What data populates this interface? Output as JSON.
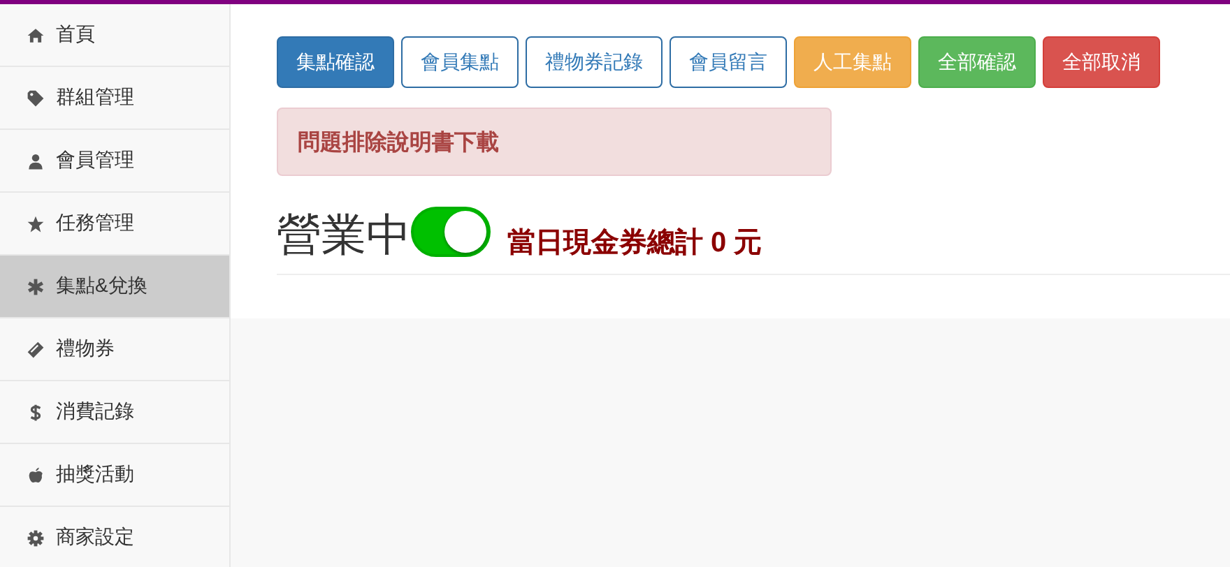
{
  "sidebar": {
    "items": [
      {
        "label": "首頁",
        "selected": false
      },
      {
        "label": "群組管理",
        "selected": false
      },
      {
        "label": "會員管理",
        "selected": false
      },
      {
        "label": "任務管理",
        "selected": false
      },
      {
        "label": "集點&兌換",
        "selected": true
      },
      {
        "label": "禮物券",
        "selected": false
      },
      {
        "label": "消費記錄",
        "selected": false
      },
      {
        "label": "抽獎活動",
        "selected": false
      },
      {
        "label": "商家設定",
        "selected": false
      }
    ]
  },
  "toolbar": {
    "buttons": [
      {
        "label": "集點確認",
        "kind": "primary"
      },
      {
        "label": "會員集點",
        "kind": "outline"
      },
      {
        "label": "禮物券記錄",
        "kind": "outline"
      },
      {
        "label": "會員留言",
        "kind": "outline"
      },
      {
        "label": "人工集點",
        "kind": "warning"
      },
      {
        "label": "全部確認",
        "kind": "success"
      },
      {
        "label": "全部取消",
        "kind": "danger"
      }
    ]
  },
  "alert": {
    "text": "問題排除說明書下載"
  },
  "status": {
    "title": "營業中",
    "on": true,
    "total": "當日現金券總計 0 元"
  }
}
